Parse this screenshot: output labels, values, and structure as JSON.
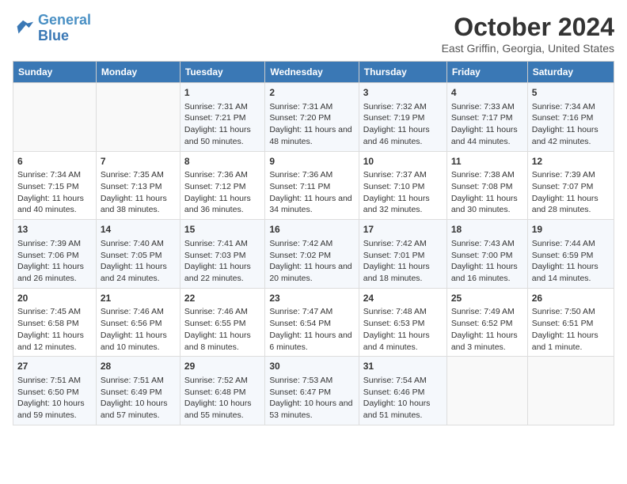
{
  "logo": {
    "line1": "General",
    "line2": "Blue"
  },
  "title": "October 2024",
  "subtitle": "East Griffin, Georgia, United States",
  "headers": [
    "Sunday",
    "Monday",
    "Tuesday",
    "Wednesday",
    "Thursday",
    "Friday",
    "Saturday"
  ],
  "weeks": [
    [
      {
        "day": "",
        "sunrise": "",
        "sunset": "",
        "daylight": ""
      },
      {
        "day": "",
        "sunrise": "",
        "sunset": "",
        "daylight": ""
      },
      {
        "day": "1",
        "sunrise": "Sunrise: 7:31 AM",
        "sunset": "Sunset: 7:21 PM",
        "daylight": "Daylight: 11 hours and 50 minutes."
      },
      {
        "day": "2",
        "sunrise": "Sunrise: 7:31 AM",
        "sunset": "Sunset: 7:20 PM",
        "daylight": "Daylight: 11 hours and 48 minutes."
      },
      {
        "day": "3",
        "sunrise": "Sunrise: 7:32 AM",
        "sunset": "Sunset: 7:19 PM",
        "daylight": "Daylight: 11 hours and 46 minutes."
      },
      {
        "day": "4",
        "sunrise": "Sunrise: 7:33 AM",
        "sunset": "Sunset: 7:17 PM",
        "daylight": "Daylight: 11 hours and 44 minutes."
      },
      {
        "day": "5",
        "sunrise": "Sunrise: 7:34 AM",
        "sunset": "Sunset: 7:16 PM",
        "daylight": "Daylight: 11 hours and 42 minutes."
      }
    ],
    [
      {
        "day": "6",
        "sunrise": "Sunrise: 7:34 AM",
        "sunset": "Sunset: 7:15 PM",
        "daylight": "Daylight: 11 hours and 40 minutes."
      },
      {
        "day": "7",
        "sunrise": "Sunrise: 7:35 AM",
        "sunset": "Sunset: 7:13 PM",
        "daylight": "Daylight: 11 hours and 38 minutes."
      },
      {
        "day": "8",
        "sunrise": "Sunrise: 7:36 AM",
        "sunset": "Sunset: 7:12 PM",
        "daylight": "Daylight: 11 hours and 36 minutes."
      },
      {
        "day": "9",
        "sunrise": "Sunrise: 7:36 AM",
        "sunset": "Sunset: 7:11 PM",
        "daylight": "Daylight: 11 hours and 34 minutes."
      },
      {
        "day": "10",
        "sunrise": "Sunrise: 7:37 AM",
        "sunset": "Sunset: 7:10 PM",
        "daylight": "Daylight: 11 hours and 32 minutes."
      },
      {
        "day": "11",
        "sunrise": "Sunrise: 7:38 AM",
        "sunset": "Sunset: 7:08 PM",
        "daylight": "Daylight: 11 hours and 30 minutes."
      },
      {
        "day": "12",
        "sunrise": "Sunrise: 7:39 AM",
        "sunset": "Sunset: 7:07 PM",
        "daylight": "Daylight: 11 hours and 28 minutes."
      }
    ],
    [
      {
        "day": "13",
        "sunrise": "Sunrise: 7:39 AM",
        "sunset": "Sunset: 7:06 PM",
        "daylight": "Daylight: 11 hours and 26 minutes."
      },
      {
        "day": "14",
        "sunrise": "Sunrise: 7:40 AM",
        "sunset": "Sunset: 7:05 PM",
        "daylight": "Daylight: 11 hours and 24 minutes."
      },
      {
        "day": "15",
        "sunrise": "Sunrise: 7:41 AM",
        "sunset": "Sunset: 7:03 PM",
        "daylight": "Daylight: 11 hours and 22 minutes."
      },
      {
        "day": "16",
        "sunrise": "Sunrise: 7:42 AM",
        "sunset": "Sunset: 7:02 PM",
        "daylight": "Daylight: 11 hours and 20 minutes."
      },
      {
        "day": "17",
        "sunrise": "Sunrise: 7:42 AM",
        "sunset": "Sunset: 7:01 PM",
        "daylight": "Daylight: 11 hours and 18 minutes."
      },
      {
        "day": "18",
        "sunrise": "Sunrise: 7:43 AM",
        "sunset": "Sunset: 7:00 PM",
        "daylight": "Daylight: 11 hours and 16 minutes."
      },
      {
        "day": "19",
        "sunrise": "Sunrise: 7:44 AM",
        "sunset": "Sunset: 6:59 PM",
        "daylight": "Daylight: 11 hours and 14 minutes."
      }
    ],
    [
      {
        "day": "20",
        "sunrise": "Sunrise: 7:45 AM",
        "sunset": "Sunset: 6:58 PM",
        "daylight": "Daylight: 11 hours and 12 minutes."
      },
      {
        "day": "21",
        "sunrise": "Sunrise: 7:46 AM",
        "sunset": "Sunset: 6:56 PM",
        "daylight": "Daylight: 11 hours and 10 minutes."
      },
      {
        "day": "22",
        "sunrise": "Sunrise: 7:46 AM",
        "sunset": "Sunset: 6:55 PM",
        "daylight": "Daylight: 11 hours and 8 minutes."
      },
      {
        "day": "23",
        "sunrise": "Sunrise: 7:47 AM",
        "sunset": "Sunset: 6:54 PM",
        "daylight": "Daylight: 11 hours and 6 minutes."
      },
      {
        "day": "24",
        "sunrise": "Sunrise: 7:48 AM",
        "sunset": "Sunset: 6:53 PM",
        "daylight": "Daylight: 11 hours and 4 minutes."
      },
      {
        "day": "25",
        "sunrise": "Sunrise: 7:49 AM",
        "sunset": "Sunset: 6:52 PM",
        "daylight": "Daylight: 11 hours and 3 minutes."
      },
      {
        "day": "26",
        "sunrise": "Sunrise: 7:50 AM",
        "sunset": "Sunset: 6:51 PM",
        "daylight": "Daylight: 11 hours and 1 minute."
      }
    ],
    [
      {
        "day": "27",
        "sunrise": "Sunrise: 7:51 AM",
        "sunset": "Sunset: 6:50 PM",
        "daylight": "Daylight: 10 hours and 59 minutes."
      },
      {
        "day": "28",
        "sunrise": "Sunrise: 7:51 AM",
        "sunset": "Sunset: 6:49 PM",
        "daylight": "Daylight: 10 hours and 57 minutes."
      },
      {
        "day": "29",
        "sunrise": "Sunrise: 7:52 AM",
        "sunset": "Sunset: 6:48 PM",
        "daylight": "Daylight: 10 hours and 55 minutes."
      },
      {
        "day": "30",
        "sunrise": "Sunrise: 7:53 AM",
        "sunset": "Sunset: 6:47 PM",
        "daylight": "Daylight: 10 hours and 53 minutes."
      },
      {
        "day": "31",
        "sunrise": "Sunrise: 7:54 AM",
        "sunset": "Sunset: 6:46 PM",
        "daylight": "Daylight: 10 hours and 51 minutes."
      },
      {
        "day": "",
        "sunrise": "",
        "sunset": "",
        "daylight": ""
      },
      {
        "day": "",
        "sunrise": "",
        "sunset": "",
        "daylight": ""
      }
    ]
  ]
}
